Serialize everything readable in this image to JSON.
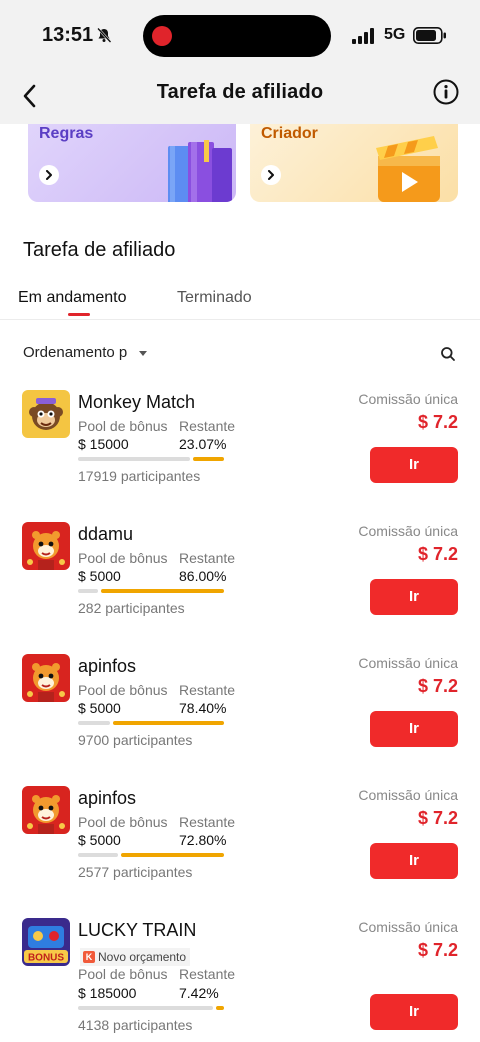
{
  "status_bar": {
    "time": "13:51",
    "network": "5G"
  },
  "header": {
    "title": "Tarefa de afiliado"
  },
  "banners": [
    {
      "label": "Regras"
    },
    {
      "label": "Criador"
    }
  ],
  "section": {
    "title": "Tarefa de afiliado"
  },
  "tabs": [
    {
      "label": "Em andamento",
      "active": true
    },
    {
      "label": "Terminado",
      "active": false
    }
  ],
  "sort": {
    "label": "Ordenamento p"
  },
  "task_labels": {
    "pool": "Pool de bônus",
    "remaining": "Restante",
    "commission": "Comissão única",
    "go": "Ir"
  },
  "tasks": [
    {
      "name": "Monkey Match",
      "pool": "$ 15000",
      "remaining": "23.07%",
      "remaining_fraction": 0.2307,
      "participants": "17919 participantes",
      "commission": "$ 7.2",
      "icon": "monkey-game-icon"
    },
    {
      "name": "ddamu",
      "pool": "$ 5000",
      "remaining": "86.00%",
      "remaining_fraction": 0.86,
      "participants": "282 participantes",
      "commission": "$ 7.2",
      "icon": "tiger-game-icon"
    },
    {
      "name": "apinfos",
      "pool": "$ 5000",
      "remaining": "78.40%",
      "remaining_fraction": 0.784,
      "participants": "9700 participantes",
      "commission": "$ 7.2",
      "icon": "tiger-game-icon"
    },
    {
      "name": "apinfos",
      "pool": "$ 5000",
      "remaining": "72.80%",
      "remaining_fraction": 0.728,
      "participants": "2577 participantes",
      "commission": "$ 7.2",
      "icon": "tiger-game-icon"
    },
    {
      "name": "LUCKY TRAIN",
      "badge": "Novo orçamento",
      "badge_letter": "K",
      "pool": "$ 185000",
      "remaining": "7.42%",
      "remaining_fraction": 0.0742,
      "participants": "4138 participantes",
      "commission": "$ 7.2",
      "icon": "bonus-game-icon"
    }
  ],
  "colors": {
    "accent_red": "#f02a2a",
    "progress_orange": "#f0a500",
    "header_bg": "#f2f2f2"
  }
}
